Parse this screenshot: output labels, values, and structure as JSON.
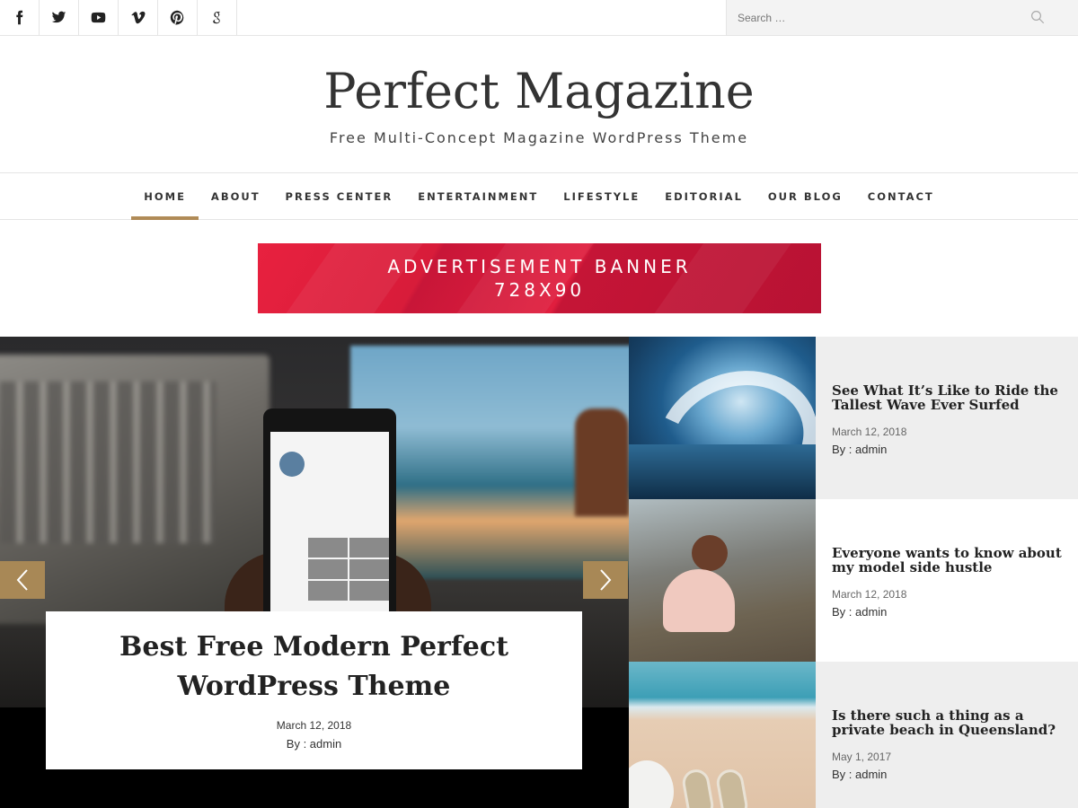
{
  "social": [
    "facebook-icon",
    "twitter-icon",
    "youtube-icon",
    "vimeo-icon",
    "pinterest-icon",
    "google-plus-icon"
  ],
  "search": {
    "placeholder": "Search …"
  },
  "site": {
    "title": "Perfect Magazine",
    "tagline": "Free Multi-Concept Magazine WordPress Theme"
  },
  "nav": {
    "items": [
      "HOME",
      "ABOUT",
      "PRESS CENTER",
      "ENTERTAINMENT",
      "LIFESTYLE",
      "EDITORIAL",
      "OUR BLOG",
      "CONTACT"
    ],
    "active": "HOME"
  },
  "ad": {
    "line1": "ADVERTISEMENT BANNER",
    "line2": "728X90"
  },
  "hero": {
    "title": "Best Free Modern Perfect WordPress Theme",
    "date": "March 12, 2018",
    "author": "By : admin"
  },
  "side_posts": [
    {
      "title": "See What It’s Like to Ride the Tallest Wave Ever Surfed",
      "date": "March 12, 2018",
      "author": "By : admin"
    },
    {
      "title": "Everyone wants to know about my model side hustle",
      "date": "March 12, 2018",
      "author": "By : admin"
    },
    {
      "title": "Is there such a thing as a private beach in Queensland?",
      "date": "May 1, 2017",
      "author": "By : admin"
    }
  ],
  "colors": {
    "accent": "#b08b57",
    "ad_red": "#d81c3a",
    "grey_panel": "#eeeeee"
  }
}
